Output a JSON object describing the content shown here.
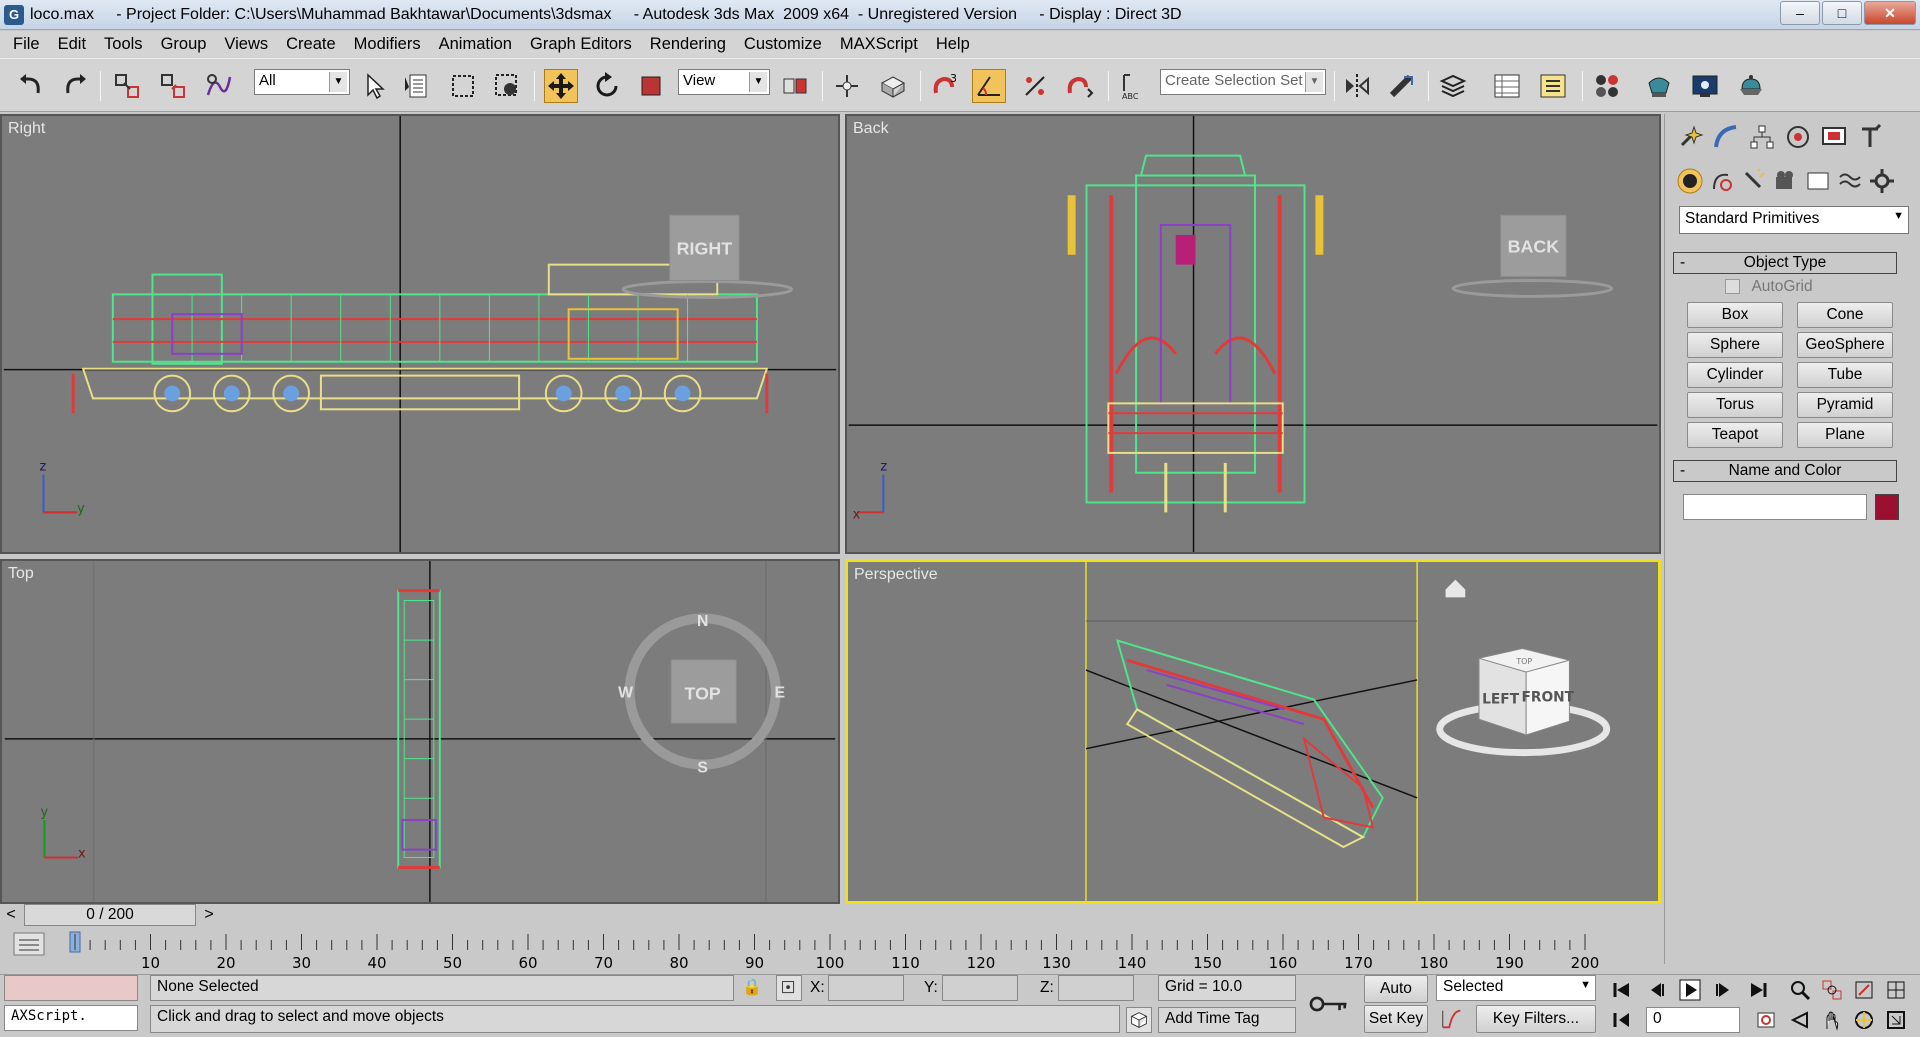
{
  "window": {
    "title": "loco.max     - Project Folder: C:\\Users\\Muhammad Bakhtawar\\Documents\\3dsmax     - Autodesk 3ds Max  2009 x64  - Unregistered Version     - Display : Direct 3D",
    "minimize": "–",
    "maximize": "□",
    "close": "✕"
  },
  "menu": [
    "File",
    "Edit",
    "Tools",
    "Group",
    "Views",
    "Create",
    "Modifiers",
    "Animation",
    "Graph Editors",
    "Rendering",
    "Customize",
    "MAXScript",
    "Help"
  ],
  "toolbar": {
    "selection_filter": "All",
    "reference_coord": "View",
    "named_selection_placeholder": "Create Selection Set",
    "snaps_toggle_label": "3",
    "edit_named_sel_label": "ABC"
  },
  "viewports": {
    "right": {
      "label": "Right",
      "cube": "RIGHT",
      "axis_up": "z",
      "axis_side": "y"
    },
    "back": {
      "label": "Back",
      "cube": "BACK",
      "axis_up": "z",
      "axis_side": "x"
    },
    "top": {
      "label": "Top",
      "cube": "TOP",
      "axis_up": "y",
      "axis_side": "x",
      "compass": [
        "N",
        "S",
        "E",
        "W"
      ]
    },
    "perspective": {
      "label": "Perspective",
      "cube_left": "LEFT",
      "cube_front": "FRONT",
      "cube_top": "TOP"
    }
  },
  "command_panel": {
    "category": "Standard Primitives",
    "object_type_title": "Object Type",
    "autogrid": "AutoGrid",
    "buttons": [
      "Box",
      "Cone",
      "Sphere",
      "GeoSphere",
      "Cylinder",
      "Tube",
      "Torus",
      "Pyramid",
      "Teapot",
      "Plane"
    ],
    "name_color_title": "Name and Color",
    "name_value": "",
    "object_color": "#9a1030",
    "collapse": "-"
  },
  "time": {
    "slider_text": "0 / 200",
    "ticks": [
      "10",
      "20",
      "30",
      "40",
      "50",
      "60",
      "70",
      "80",
      "90",
      "100",
      "110",
      "120",
      "130",
      "140",
      "150",
      "160",
      "170",
      "180",
      "190",
      "200"
    ],
    "prev": "<",
    "next": ">"
  },
  "status": {
    "maxscript_listener": "AXScript.",
    "selection": "None Selected",
    "prompt": "Click and drag to select and move objects",
    "x_label": "X:",
    "y_label": "Y:",
    "z_label": "Z:",
    "x_value": "",
    "y_value": "",
    "z_value": "",
    "grid": "Grid = 10.0",
    "add_time_tag": "Add Time Tag",
    "auto_key": "Auto Key",
    "set_key": "Set Key",
    "key_mode": "Selected",
    "key_filters": "Key Filters...",
    "current_frame": "0"
  },
  "colors": {
    "viewport_bg": "#7c7c7c",
    "active_border": "#f0e01a",
    "wire_green": "#4ee68a",
    "wire_red": "#e23a3a",
    "wire_yellow": "#e8e088",
    "wire_purple": "#8a40c8"
  }
}
